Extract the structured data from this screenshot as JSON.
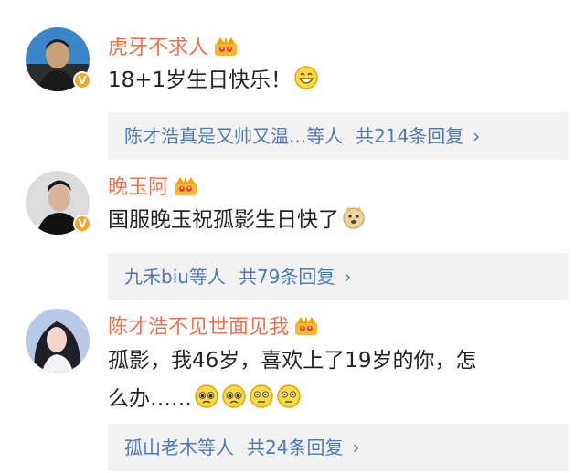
{
  "comments": [
    {
      "username": "虎牙不求人",
      "text": "18+1岁生日快乐！",
      "verified_color": "#f5a623",
      "verified_mark": "V",
      "emojis": [
        "grin-emoji"
      ],
      "replies": {
        "names": "陈才浩真是又帅又温...等人",
        "count": "共214条回复",
        "chevron": "›"
      }
    },
    {
      "username": "晚玉阿",
      "text": "国服晚玉祝孤影生日快了",
      "verified_color": "#f5a623",
      "verified_mark": "V",
      "emojis": [
        "doge-emoji"
      ],
      "replies": {
        "names": "九禾biu等人",
        "count": "共79条回复",
        "chevron": "›"
      }
    },
    {
      "username": "陈才浩不见世面见我",
      "text_line1": "孤影，我46岁，喜欢上了19岁的你，怎",
      "text_line2": "么办……",
      "emojis": [
        "pleading-emoji",
        "pleading-emoji",
        "flushed-emoji",
        "flushed-emoji"
      ],
      "replies": {
        "names": "孤山老木等人",
        "count": "共24条回复",
        "chevron": "›"
      }
    }
  ],
  "colors": {
    "username": "#eb7350",
    "link": "#4e79b5",
    "reply_bg": "#f2f2f2"
  }
}
